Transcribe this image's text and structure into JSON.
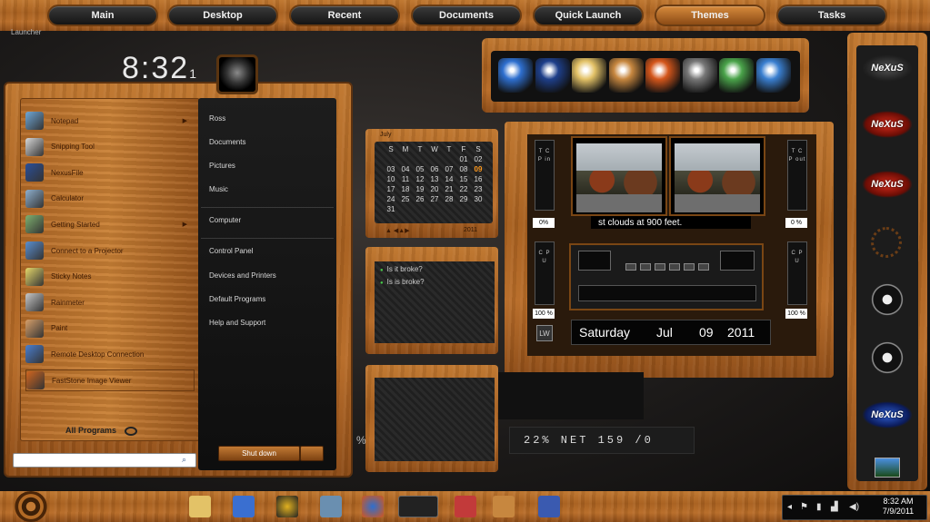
{
  "top_menu": {
    "items": [
      {
        "label": "Main"
      },
      {
        "label": "Desktop"
      },
      {
        "label": "Recent"
      },
      {
        "label": "Documents"
      },
      {
        "label": "Quick Launch"
      },
      {
        "label": "Themes",
        "active": true
      },
      {
        "label": "Tasks"
      }
    ],
    "launcher_label": "Launcher"
  },
  "clock": "8:32",
  "clock_suffix": "1",
  "start_menu": {
    "programs": [
      {
        "label": "Notepad",
        "icon": "notepad-icon",
        "has_submenu": true,
        "color": "#6fa8d8"
      },
      {
        "label": "Snipping Tool",
        "icon": "scissors-icon",
        "has_submenu": false,
        "color": "#d8d8d8"
      },
      {
        "label": "NexusFile",
        "icon": "folder-blue-icon",
        "has_submenu": false,
        "color": "#2a4f9a"
      },
      {
        "label": "Calculator",
        "icon": "calculator-icon",
        "has_submenu": false,
        "color": "#8fb0cf"
      },
      {
        "label": "Getting Started",
        "icon": "getting-started-icon",
        "has_submenu": true,
        "color": "#7fb06f"
      },
      {
        "label": "Connect to a Projector",
        "icon": "projector-icon",
        "has_submenu": false,
        "color": "#5a8fd0"
      },
      {
        "label": "Sticky Notes",
        "icon": "sticky-note-icon",
        "has_submenu": false,
        "color": "#e6d86a"
      },
      {
        "label": "Rainmeter",
        "icon": "droplet-icon",
        "has_submenu": false,
        "color": "#c8c8c8"
      },
      {
        "label": "Paint",
        "icon": "palette-icon",
        "has_submenu": false,
        "color": "#d8a06a"
      },
      {
        "label": "Remote Desktop Connection",
        "icon": "remote-desktop-icon",
        "has_submenu": false,
        "color": "#4a7fd0"
      },
      {
        "label": "FastStone Image Viewer",
        "icon": "eye-icon",
        "has_submenu": false,
        "color": "#d0651f"
      }
    ],
    "all_programs": "All Programs",
    "places": [
      {
        "label": "Ross"
      },
      {
        "label": "Documents"
      },
      {
        "label": "Pictures"
      },
      {
        "label": "Music"
      },
      {
        "label": "Computer"
      },
      {
        "label": "Control Panel"
      },
      {
        "label": "Devices and Printers"
      },
      {
        "label": "Default Programs"
      },
      {
        "label": "Help and Support"
      }
    ],
    "search_placeholder": "",
    "shutdown_label": "Shut down"
  },
  "calendar": {
    "month": "July",
    "year": "2011",
    "weekdays": [
      "S",
      "M",
      "T",
      "W",
      "T",
      "F",
      "S"
    ],
    "days": [
      "",
      "",
      "",
      "",
      "",
      "01",
      "02",
      "03",
      "04",
      "05",
      "06",
      "07",
      "08",
      "09",
      "10",
      "11",
      "12",
      "13",
      "14",
      "15",
      "16",
      "17",
      "18",
      "19",
      "20",
      "21",
      "22",
      "23",
      "24",
      "25",
      "26",
      "27",
      "28",
      "29",
      "30",
      "31",
      "",
      "",
      "",
      "",
      "",
      ""
    ],
    "today": "09"
  },
  "notes": {
    "items": [
      "Is it broke?",
      "Is is broke?"
    ]
  },
  "dock": {
    "icons": [
      {
        "name": "windows-orb-icon",
        "color": "#2e6fcf"
      },
      {
        "name": "dlopc-icon",
        "color": "#1e3f8a"
      },
      {
        "name": "folder-icon",
        "color": "#e3c267"
      },
      {
        "name": "paint-palette-icon",
        "color": "#c7873f"
      },
      {
        "name": "firefox-icon",
        "color": "#d4561b"
      },
      {
        "name": "gear-icon",
        "color": "#777777"
      },
      {
        "name": "tools-icon",
        "color": "#4aa34a"
      },
      {
        "name": "settings-blue-icon",
        "color": "#3a7fd0"
      }
    ]
  },
  "media": {
    "weather_text": "st clouds at 900 feet.",
    "tcp_in_label": "T C P in",
    "tcp_out_label": "T C P out",
    "cpu_left_label": "C P U",
    "cpu_right_label": "C P U",
    "pct_tl": "0%",
    "pct_tr": "0 %",
    "pct_bl": "100 %",
    "pct_br": "100 %",
    "date": {
      "day": "Saturday",
      "month": "Jul",
      "date": "09",
      "year": "2011"
    },
    "lw_label": "LW"
  },
  "net": {
    "text": "22%    NET  159  /0",
    "left_pct": "%"
  },
  "sidebar": {
    "nexus_label": "NeXuS"
  },
  "tray": {
    "time": "8:32 AM",
    "date": "7/9/2011"
  },
  "colors": {
    "wood": "#b86c28",
    "accent": "#ff9a1f"
  }
}
